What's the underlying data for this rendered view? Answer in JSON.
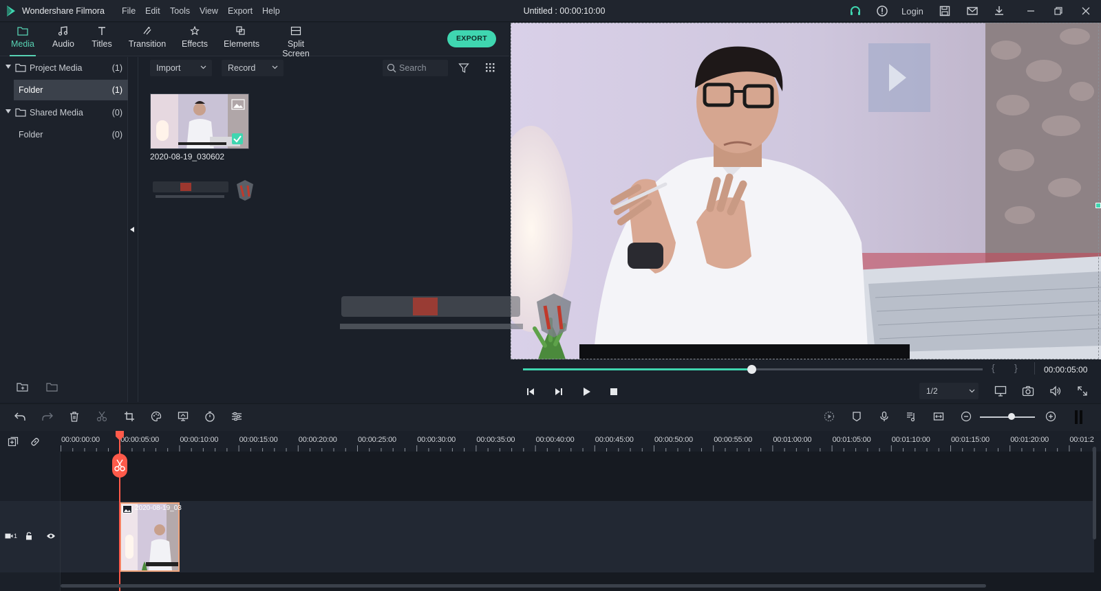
{
  "app": {
    "name": "Wondershare Filmora",
    "menu": [
      "File",
      "Edit",
      "Tools",
      "View",
      "Export",
      "Help"
    ],
    "document_title": "Untitled : 00:00:10:00",
    "login_label": "Login"
  },
  "tabs": [
    {
      "label": "Media",
      "icon": "folder-icon",
      "active": true
    },
    {
      "label": "Audio",
      "icon": "music-note-icon",
      "active": false
    },
    {
      "label": "Titles",
      "icon": "text-t-icon",
      "active": false
    },
    {
      "label": "Transition",
      "icon": "transition-icon",
      "active": false
    },
    {
      "label": "Effects",
      "icon": "effects-sparkle-icon",
      "active": false
    },
    {
      "label": "Elements",
      "icon": "elements-icon",
      "active": false
    },
    {
      "label": "Split Screen",
      "icon": "split-screen-icon",
      "active": false
    }
  ],
  "export_label": "EXPORT",
  "media_tree": [
    {
      "label": "Project Media",
      "count": "(1)",
      "type": "group"
    },
    {
      "label": "Folder",
      "count": "(1)",
      "type": "folder",
      "selected": true
    },
    {
      "label": "Shared Media",
      "count": "(0)",
      "type": "group"
    },
    {
      "label": "Folder",
      "count": "(0)",
      "type": "folder",
      "selected": false
    }
  ],
  "media_toolbar": {
    "import_label": "Import",
    "record_label": "Record",
    "search_placeholder": "Search"
  },
  "media_items": [
    {
      "name": "2020-08-19_030602",
      "checked": true
    }
  ],
  "preview": {
    "timecode": "00:00:05:00",
    "brace_open": "{",
    "brace_close": "}",
    "ratio": "1/2",
    "progress": 0.49
  },
  "timeline": {
    "ruler_labels": [
      "00:00:00:00",
      "00:00:05:00",
      "00:00:10:00",
      "00:00:15:00",
      "00:00:20:00",
      "00:00:25:00",
      "00:00:30:00",
      "00:00:35:00",
      "00:00:40:00",
      "00:00:45:00",
      "00:00:50:00",
      "00:00:55:00",
      "00:01:00:00",
      "00:01:05:00",
      "00:01:10:00",
      "00:01:15:00",
      "00:01:20:00",
      "00:01:2"
    ],
    "track_label": "1",
    "clip_name": "2020-08-19_03",
    "zoom_level": 0.55
  },
  "colors": {
    "accent": "#3fd6b0",
    "playhead": "#ff5a4a",
    "clip_border": "#f0a57c"
  }
}
